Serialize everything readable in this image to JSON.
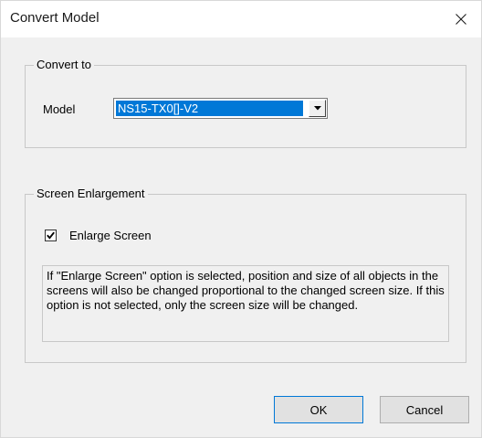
{
  "window": {
    "title": "Convert Model",
    "close_glyph": "close-icon"
  },
  "convert_to": {
    "group_label": "Convert to",
    "model_label": "Model",
    "model_value": "NS15-TX0[]-V2"
  },
  "screen_enlargement": {
    "group_label": "Screen Enlargement",
    "enlarge_label": "Enlarge Screen",
    "enlarge_checked": true,
    "info_text": "If \"Enlarge Screen\" option is selected, position and size of all objects in the screens will also be changed proportional to the changed screen size. If this option is not selected, only the screen size will be changed."
  },
  "buttons": {
    "ok_label": "OK",
    "cancel_label": "Cancel"
  },
  "colors": {
    "selection_blue": "#0078d7",
    "dialog_bg": "#f0f0f0"
  }
}
